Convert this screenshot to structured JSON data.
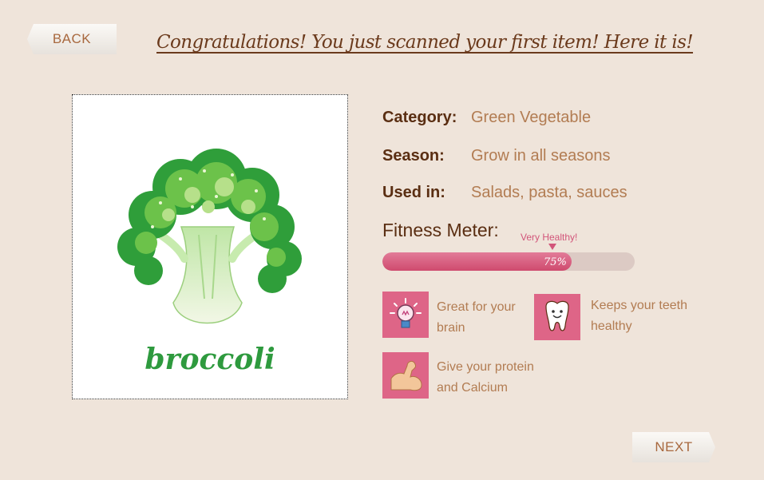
{
  "nav": {
    "back_label": "BACK",
    "next_label": "NEXT"
  },
  "headline": "Congratulations! You just scanned your first item! Here it is!",
  "item": {
    "name": "broccoli",
    "image_icon": "broccoli-illustration"
  },
  "details": [
    {
      "label": "Category:",
      "value": "Green Vegetable"
    },
    {
      "label": "Season:",
      "value": "Grow in all seasons"
    },
    {
      "label": "Used in:",
      "value": "Salads, pasta, sauces"
    }
  ],
  "fitness": {
    "title": "Fitness Meter:",
    "marker_label": "Very Healthy!",
    "value_percent": 75,
    "value_label": "75%"
  },
  "benefits": [
    {
      "icon": "lightbulb-icon",
      "text_line1": "Great for your",
      "text_line2": "brain"
    },
    {
      "icon": "tooth-icon",
      "text_line1": "Keeps your teeth",
      "text_line2": "healthy"
    },
    {
      "icon": "muscle-arm-icon",
      "text_line1": "Give your protein",
      "text_line2": "and Calcium"
    }
  ],
  "colors": {
    "background": "#efe4da",
    "accent_pink": "#de6587",
    "brown_text": "#5a2e12",
    "tan_text": "#b27c52",
    "broccoli_green": "#2e9a3e"
  }
}
